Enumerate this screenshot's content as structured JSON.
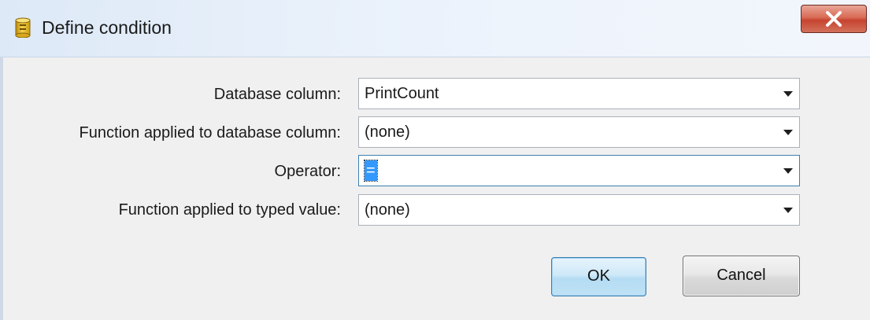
{
  "window": {
    "title": "Define condition",
    "title_icon": "database-icon",
    "close_icon": "close-icon",
    "colors": {
      "close_button": "#c64430",
      "selection": "#3399ff",
      "focus_border": "#3c7fb1"
    }
  },
  "form": {
    "fields": [
      {
        "label": "Database column:",
        "value": "PrintCount"
      },
      {
        "label": "Function applied to database column:",
        "value": "(none)"
      },
      {
        "label": "Operator:",
        "value": "="
      },
      {
        "label": "Function applied to typed value:",
        "value": "(none)"
      }
    ]
  },
  "buttons": {
    "ok": "OK",
    "cancel": "Cancel"
  }
}
